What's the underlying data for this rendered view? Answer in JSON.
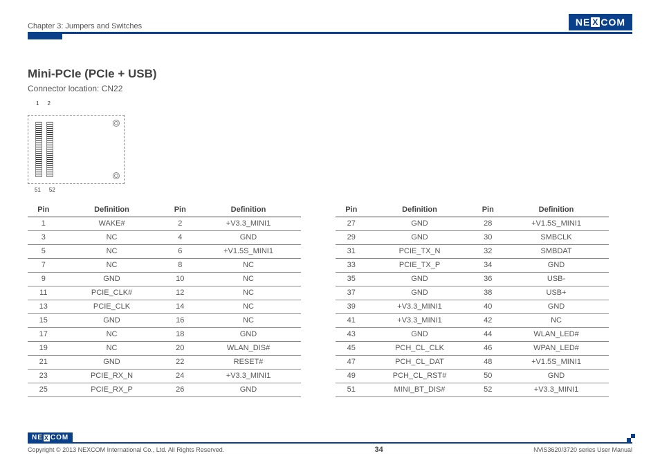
{
  "header": {
    "chapter": "Chapter 3: Jumpers and Switches",
    "brand_left": "NE",
    "brand_x": "X",
    "brand_right": "COM"
  },
  "main": {
    "title": "Mini-PCIe (PCIe + USB)",
    "subtitle": "Connector location: CN22",
    "pin_tl": "1",
    "pin_tr": "2",
    "pin_bl": "51",
    "pin_br": "52"
  },
  "table_headers": {
    "pin": "Pin",
    "def": "Definition"
  },
  "left_rows": [
    {
      "p1": "1",
      "d1": "WAKE#",
      "p2": "2",
      "d2": "+V3.3_MINI1"
    },
    {
      "p1": "3",
      "d1": "NC",
      "p2": "4",
      "d2": "GND"
    },
    {
      "p1": "5",
      "d1": "NC",
      "p2": "6",
      "d2": "+V1.5S_MINI1"
    },
    {
      "p1": "7",
      "d1": "NC",
      "p2": "8",
      "d2": "NC"
    },
    {
      "p1": "9",
      "d1": "GND",
      "p2": "10",
      "d2": "NC"
    },
    {
      "p1": "11",
      "d1": "PCIE_CLK#",
      "p2": "12",
      "d2": "NC"
    },
    {
      "p1": "13",
      "d1": "PCIE_CLK",
      "p2": "14",
      "d2": "NC"
    },
    {
      "p1": "15",
      "d1": "GND",
      "p2": "16",
      "d2": "NC"
    },
    {
      "p1": "17",
      "d1": "NC",
      "p2": "18",
      "d2": "GND"
    },
    {
      "p1": "19",
      "d1": "NC",
      "p2": "20",
      "d2": "WLAN_DIS#"
    },
    {
      "p1": "21",
      "d1": "GND",
      "p2": "22",
      "d2": "RESET#"
    },
    {
      "p1": "23",
      "d1": "PCIE_RX_N",
      "p2": "24",
      "d2": "+V3.3_MINI1"
    },
    {
      "p1": "25",
      "d1": "PCIE_RX_P",
      "p2": "26",
      "d2": "GND"
    }
  ],
  "right_rows": [
    {
      "p1": "27",
      "d1": "GND",
      "p2": "28",
      "d2": "+V1.5S_MINI1"
    },
    {
      "p1": "29",
      "d1": "GND",
      "p2": "30",
      "d2": "SMBCLK"
    },
    {
      "p1": "31",
      "d1": "PCIE_TX_N",
      "p2": "32",
      "d2": "SMBDAT"
    },
    {
      "p1": "33",
      "d1": "PCIE_TX_P",
      "p2": "34",
      "d2": "GND"
    },
    {
      "p1": "35",
      "d1": "GND",
      "p2": "36",
      "d2": "USB-"
    },
    {
      "p1": "37",
      "d1": "GND",
      "p2": "38",
      "d2": "USB+"
    },
    {
      "p1": "39",
      "d1": "+V3.3_MINI1",
      "p2": "40",
      "d2": "GND"
    },
    {
      "p1": "41",
      "d1": "+V3.3_MINI1",
      "p2": "42",
      "d2": "NC"
    },
    {
      "p1": "43",
      "d1": "GND",
      "p2": "44",
      "d2": "WLAN_LED#"
    },
    {
      "p1": "45",
      "d1": "PCH_CL_CLK",
      "p2": "46",
      "d2": "WPAN_LED#"
    },
    {
      "p1": "47",
      "d1": "PCH_CL_DAT",
      "p2": "48",
      "d2": "+V1.5S_MINI1"
    },
    {
      "p1": "49",
      "d1": "PCH_CL_RST#",
      "p2": "50",
      "d2": "GND"
    },
    {
      "p1": "51",
      "d1": "MINI_BT_DIS#",
      "p2": "52",
      "d2": "+V3.3_MINI1"
    }
  ],
  "footer": {
    "copyright": "Copyright © 2013 NEXCOM International Co., Ltd. All Rights Reserved.",
    "page": "34",
    "manual": "NViS3620/3720 series User Manual"
  }
}
